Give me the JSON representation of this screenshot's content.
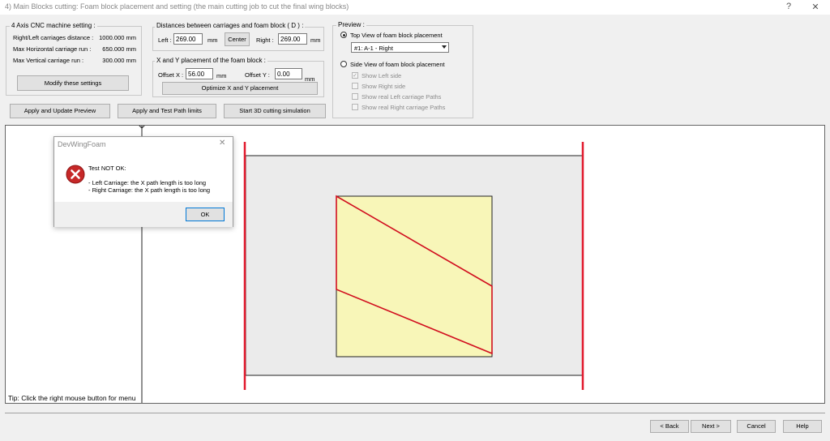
{
  "window": {
    "title": "4) Main Blocks cutting: Foam block placement and setting (the main cutting job to cut the final wing blocks)",
    "help_glyph": "?",
    "close_glyph": "✕"
  },
  "machine": {
    "title": "4 Axis CNC machine setting :",
    "rows": [
      {
        "label": "Right/Left carriages distance :",
        "value": "1000.000 mm"
      },
      {
        "label": "Max Horizontal carriage run :",
        "value": "650.000 mm"
      },
      {
        "label": "Max Vertical carriage run :",
        "value": "300.000 mm"
      }
    ],
    "modify_button": "Modify these settings"
  },
  "distances": {
    "title": "Distances between carriages and foam block  ( D ) :",
    "left_label": "Left :",
    "left_value": "269.00",
    "unit": "mm",
    "center_button": "Center",
    "right_label": "Right :",
    "right_value": "269.00"
  },
  "placement": {
    "title": "X and Y placement of the  foam block :",
    "offset_x_label": "Offset X :",
    "offset_x_value": "56.00",
    "offset_y_label": "Offset Y :",
    "offset_y_value": "0.00",
    "unit": "mm",
    "optimize_button": "Optimize X and Y placement"
  },
  "actions": {
    "apply_update": "Apply and Update Preview",
    "apply_test": "Apply and Test Path limits",
    "simulation": "Start 3D cutting simulation"
  },
  "preview": {
    "title": "Preview :",
    "top_view_label": "Top View of foam block placement",
    "top_view_selected": true,
    "block_select_value": "#1: A-1 - Right",
    "side_view_label": "Side View of foam block placement",
    "side_view_selected": false,
    "options": [
      {
        "label": "Show Left side",
        "checked": true
      },
      {
        "label": "Show Right side",
        "checked": false
      },
      {
        "label": "Show real Left carriage Paths",
        "checked": false
      },
      {
        "label": "Show real Right carriage Paths",
        "checked": false
      }
    ]
  },
  "canvas": {
    "tip": "Tip: Click the right mouse button for menu",
    "colors": {
      "carriage": "#e2192c",
      "foam": "#f8f6b8",
      "block_area": "#ebebeb",
      "path": "#d10f1f"
    }
  },
  "dialog": {
    "title": "DevWingFoam",
    "heading": "Test NOT OK:",
    "line1": "- Left Carriage: the X path length is too long",
    "line2": "- Right Carriage: the X path length is too long",
    "ok_button": "OK",
    "icon": "error-icon"
  },
  "footer": {
    "back": "< Back",
    "next": "Next >",
    "cancel": "Cancel",
    "help": "Help"
  }
}
